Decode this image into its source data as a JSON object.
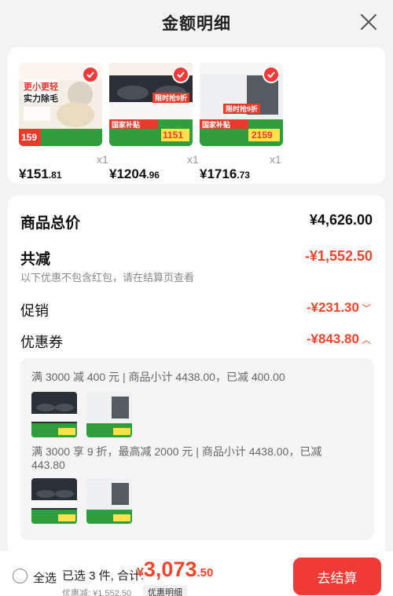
{
  "header": {
    "title": "金额明细"
  },
  "products": [
    {
      "price_int": "¥151",
      "price_dec": ".81",
      "qty": "x1",
      "badge": "更小更轻",
      "badge2": "实力除毛",
      "banner": "159"
    },
    {
      "price_int": "¥1204",
      "price_dec": ".96",
      "qty": "x1",
      "badge": "限时抢9折",
      "badge2": "国家补贴",
      "banner": "1151"
    },
    {
      "price_int": "¥1716",
      "price_dec": ".73",
      "qty": "x1",
      "badge": "限时抢9折",
      "badge2": "国家补贴",
      "banner": "2159"
    }
  ],
  "detail": {
    "goods_total_label": "商品总价",
    "goods_total_value": "¥4,626.00",
    "reduce_label": "共减",
    "reduce_value": "-¥1,552.50",
    "reduce_note": "以下优惠不包含红包，请在结算页查看",
    "promo_label": "促销",
    "promo_value": "-¥231.30",
    "coupon_label": "优惠券",
    "coupon_value": "-¥843.80"
  },
  "coupons": [
    {
      "text": "满 3000 减 400 元 | 商品小计 4438.00，已减 400.00"
    },
    {
      "text_line1": "满 3000 享 9 折，最高减 2000 元 | 商品小计 4438.00，已减",
      "text_line2": "443.80"
    }
  ],
  "bottom": {
    "select_all": "全选",
    "selected": "已选 3 件, 合计:",
    "total_sym": "¥",
    "total_int": "3,073",
    "total_dec": ".50",
    "discount": "优惠减: ¥1,552.50",
    "detail_tag": "优惠明细",
    "checkout": "去结算"
  },
  "colors": {
    "accent": "#ee3b36",
    "price_red": "#f0442b"
  }
}
